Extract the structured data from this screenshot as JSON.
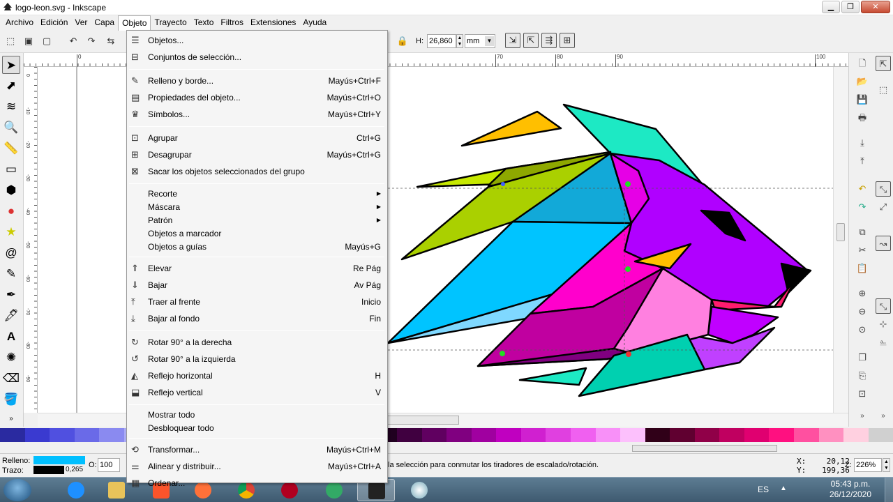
{
  "window": {
    "title": "logo-leon.svg - Inkscape"
  },
  "menubar": [
    "Archivo",
    "Edición",
    "Ver",
    "Capa",
    "Objeto",
    "Trayecto",
    "Texto",
    "Filtros",
    "Extensiones",
    "Ayuda"
  ],
  "toolbar": {
    "h_label": "H:",
    "h_value": "26,860",
    "unit": "mm"
  },
  "ruler": {
    "labels": [
      "0",
      "10",
      "70",
      "80",
      "90",
      "100"
    ],
    "v_labels": [
      "0",
      "-10",
      "-20",
      "-30",
      "-40",
      "-50",
      "-60",
      "-70",
      "-80",
      "-90"
    ]
  },
  "object_menu": [
    {
      "label": "Objetos...",
      "shortcut": "",
      "icon": "objects-icon"
    },
    {
      "label": "Conjuntos de selección...",
      "shortcut": "",
      "icon": "selection-sets-icon"
    },
    {
      "sep": true
    },
    {
      "label": "Relleno y borde...",
      "shortcut": "Mayús+Ctrl+F",
      "icon": "fill-stroke-icon"
    },
    {
      "label": "Propiedades del objeto...",
      "shortcut": "Mayús+Ctrl+O",
      "icon": "object-properties-icon"
    },
    {
      "label": "Símbolos...",
      "shortcut": "Mayús+Ctrl+Y",
      "icon": "symbols-icon"
    },
    {
      "sep": true
    },
    {
      "label": "Agrupar",
      "shortcut": "Ctrl+G",
      "icon": "group-icon"
    },
    {
      "label": "Desagrupar",
      "shortcut": "Mayús+Ctrl+G",
      "icon": "ungroup-icon"
    },
    {
      "label": "Sacar los objetos seleccionados del grupo",
      "shortcut": "",
      "icon": "pop-from-group-icon"
    },
    {
      "sep": true
    },
    {
      "label": "Recorte",
      "shortcut": "",
      "submenu": true
    },
    {
      "label": "Máscara",
      "shortcut": "",
      "submenu": true
    },
    {
      "label": "Patrón",
      "shortcut": "",
      "submenu": true
    },
    {
      "label": "Objetos a marcador",
      "shortcut": ""
    },
    {
      "label": "Objetos a guías",
      "shortcut": "Mayús+G"
    },
    {
      "sep": true
    },
    {
      "label": "Elevar",
      "shortcut": "Re Pág",
      "icon": "raise-icon"
    },
    {
      "label": "Bajar",
      "shortcut": "Av Pág",
      "icon": "lower-icon"
    },
    {
      "label": "Traer al frente",
      "shortcut": "Inicio",
      "icon": "raise-to-top-icon"
    },
    {
      "label": "Bajar al fondo",
      "shortcut": "Fin",
      "icon": "lower-to-bottom-icon"
    },
    {
      "sep": true
    },
    {
      "label": "Rotar 90° a la derecha",
      "shortcut": "",
      "icon": "rotate-cw-icon"
    },
    {
      "label": "Rotar 90° a la izquierda",
      "shortcut": "",
      "icon": "rotate-ccw-icon"
    },
    {
      "label": "Reflejo horizontal",
      "shortcut": "H",
      "icon": "flip-horizontal-icon"
    },
    {
      "label": "Reflejo vertical",
      "shortcut": "V",
      "icon": "flip-vertical-icon"
    },
    {
      "sep": true
    },
    {
      "label": "Mostrar todo",
      "shortcut": ""
    },
    {
      "label": "Desbloquear todo",
      "shortcut": ""
    },
    {
      "sep": true
    },
    {
      "label": "Transformar...",
      "shortcut": "Mayús+Ctrl+M",
      "icon": "transform-icon"
    },
    {
      "label": "Alinear y distribuir...",
      "shortcut": "Mayús+Ctrl+A",
      "icon": "align-distribute-icon"
    },
    {
      "label": "Ordenar...",
      "shortcut": "",
      "icon": "arrange-icon"
    }
  ],
  "status": {
    "fill_label": "Relleno:",
    "stroke_label": "Trazo:",
    "fill_color": "#00bfff",
    "stroke_width": "0,265",
    "opacity_label": "O:",
    "opacity_value": "100",
    "message": "la selección para conmutar los tiradores de escalado/rotación.",
    "x_label": "X:",
    "x_value": "20,12",
    "y_label": "Y:",
    "y_value": "199,36",
    "zoom_label": "Z:",
    "zoom_value": "226%"
  },
  "taskbar": {
    "lang": "ES",
    "time": "05:43 p.m.",
    "date": "26/12/2020"
  },
  "colors": {
    "accent": "#00bfff",
    "menu_bg": "#f5f5f5",
    "taskbar": "#4b687e"
  }
}
